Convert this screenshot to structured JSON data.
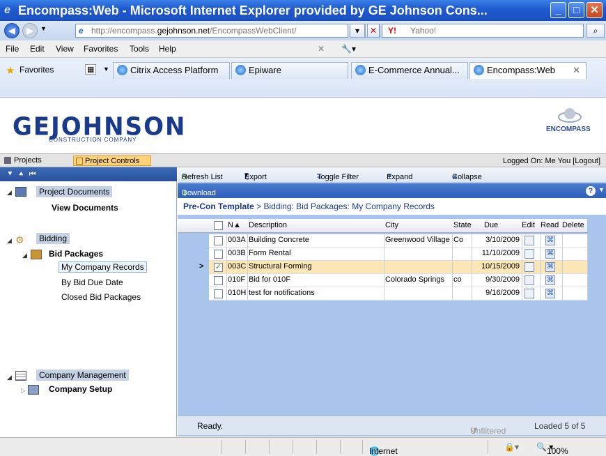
{
  "window": {
    "title": "Encompass:Web - Microsoft Internet Explorer provided by GE Johnson Cons..."
  },
  "addressbar": {
    "url_grey": "http://encompass.",
    "url_bold": "gejohnson.net",
    "url_rest": "/EncompassWebClient/",
    "search_placeholder": "Yahoo!"
  },
  "menu": {
    "items": [
      "File",
      "Edit",
      "View",
      "Favorites",
      "Tools",
      "Help"
    ]
  },
  "favorites": {
    "label": "Favorites",
    "tabs": [
      "Citrix Access Platform",
      "Epiware",
      "E-Commerce Annual...",
      "Encompass:Web"
    ]
  },
  "brand": {
    "logo": "GEJOHNSON",
    "logo_sub": "CONSTRUCTION COMPANY",
    "product": "ENCOMPASS"
  },
  "apptabs": {
    "projects": "Projects",
    "controls": "Project Controls",
    "logged": "Logged On: Me You  [Logout]"
  },
  "tree": {
    "project_documents": "Project Documents",
    "view_documents": "View Documents",
    "bidding": "Bidding",
    "bid_packages": "Bid Packages",
    "my_company_records": "My Company Records",
    "by_bid_due_date": "By Bid Due Date",
    "closed_bid_packages": "Closed Bid Packages",
    "company_management": "Company Management",
    "company_setup": "Company Setup"
  },
  "toolbar": {
    "refresh": "Refresh List",
    "export": "Export",
    "toggle_filter": "Toggle Filter",
    "expand": "Expand",
    "collapse": "Collapse",
    "download": "Download Attachments"
  },
  "breadcrumb": {
    "root": "Pre-Con Template",
    "path": " > Bidding: Bid Packages: My Company Records"
  },
  "grid": {
    "headers": {
      "num": "N",
      "description": "Description",
      "city": "City",
      "state": "State",
      "due": "Due",
      "edit": "Edit",
      "read": "Read",
      "delete": "Delete"
    },
    "rows": [
      {
        "num": "003A",
        "description": "Building Concrete",
        "city": "Greenwood Village",
        "state": "Co",
        "due": "3/10/2009",
        "checked": ""
      },
      {
        "num": "003B",
        "description": "Form Rental",
        "city": "",
        "state": "",
        "due": "11/10/2009",
        "checked": ""
      },
      {
        "num": "003C",
        "description": "Structural Forming",
        "city": "",
        "state": "",
        "due": "10/15/2009",
        "checked": "✓"
      },
      {
        "num": "010F",
        "description": "Bid for 010F",
        "city": "Colorado Springs",
        "state": "co",
        "due": "9/30/2009",
        "checked": ""
      },
      {
        "num": "010H",
        "description": "test for notifications",
        "city": "",
        "state": "",
        "due": "9/16/2009",
        "checked": ""
      }
    ]
  },
  "appstatus": {
    "ready": "Ready.",
    "filter": "Unfiltered",
    "loaded": "Loaded 5 of 5"
  },
  "iestatus": {
    "zone": "Internet",
    "zoom": "100%"
  }
}
